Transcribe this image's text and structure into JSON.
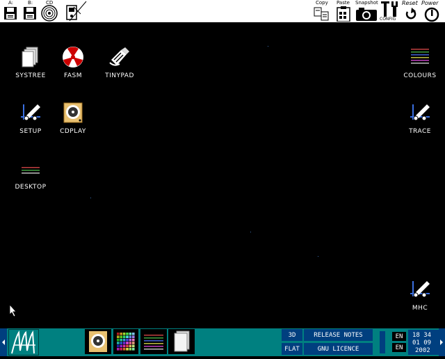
{
  "topbar": {
    "drives": [
      {
        "label": "A:",
        "icon": "floppy-a-icon"
      },
      {
        "label": "B:",
        "icon": "floppy-b-icon"
      },
      {
        "label": "CD",
        "icon": "cd-icon"
      },
      {
        "label": "",
        "icon": "hd-icon"
      }
    ],
    "tools": [
      {
        "label": "Copy",
        "icon": "copy-icon"
      },
      {
        "label": "Paste",
        "icon": "paste-icon"
      },
      {
        "label": "Snapshot",
        "icon": "camera-icon"
      },
      {
        "label": "CONFIG",
        "icon": "config-icon"
      },
      {
        "label": "Reset",
        "icon": "reset-icon"
      },
      {
        "label": "Power",
        "icon": "power-icon"
      }
    ]
  },
  "desktop": {
    "icons": [
      {
        "label": "SYSTREE",
        "icon": "systree-icon"
      },
      {
        "label": "FASM",
        "icon": "fasm-icon"
      },
      {
        "label": "TINYPAD",
        "icon": "tinypad-icon"
      },
      {
        "label": "SETUP",
        "icon": "setup-icon"
      },
      {
        "label": "CDPLAY",
        "icon": "cdplay-icon"
      },
      {
        "label": "DESKTOP",
        "icon": "desktop-icon"
      },
      {
        "label": "COLOURS",
        "icon": "colours-icon"
      },
      {
        "label": "TRACE",
        "icon": "trace-icon"
      },
      {
        "label": "MHC",
        "icon": "mhc-icon"
      }
    ]
  },
  "taskbar": {
    "menu_logo": "KolibriOS menu",
    "quick_icons": [
      "speaker-icon",
      "palette-icon",
      "lines-icon",
      "document-icon"
    ],
    "btn_3d": "3D",
    "btn_flat": "FLAT",
    "release_notes": "RELEASE NOTES",
    "gnu_licence": "GNU LICENCE",
    "lang1": "EN",
    "lang2": "EN",
    "time": "18 34",
    "date": "01 09",
    "year": "2002"
  },
  "colors": {
    "taskbar": "#008080",
    "button_blue": "#003f7f",
    "desktop_bg": "#000000"
  }
}
